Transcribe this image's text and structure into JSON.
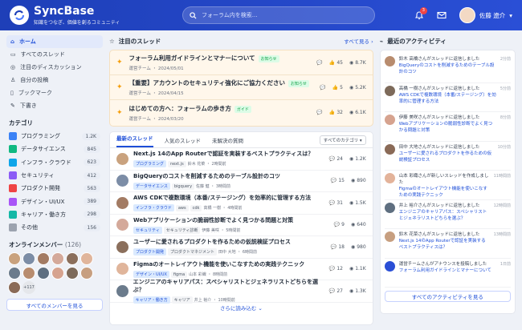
{
  "header": {
    "brand": "SyncBase",
    "tagline": "知識をつなぎ、価値を創るコミュニティ",
    "search_placeholder": "フォーラム内を検索...",
    "notif_count": "3",
    "username": "佐藤 遼介"
  },
  "colors": {
    "header_bg": "#1e3fb8",
    "accent": "#1d4ed8",
    "pin": "#f59e0b"
  },
  "nav": [
    {
      "label": "ホーム",
      "icon": "home-icon"
    },
    {
      "label": "すべてのスレッド",
      "icon": "thread-icon"
    },
    {
      "label": "注目のディスカッション",
      "icon": "chat-icon"
    },
    {
      "label": "自分の投稿",
      "icon": "user-icon"
    },
    {
      "label": "ブックマーク",
      "icon": "bookmark-icon"
    },
    {
      "label": "下書き",
      "icon": "draft-icon"
    }
  ],
  "categories_title": "カテゴリ",
  "categories": [
    {
      "name": "プログラミング",
      "count": "1.2K",
      "color": "#3b82f6"
    },
    {
      "name": "データサイエンス",
      "count": "845",
      "color": "#10b981"
    },
    {
      "name": "インフラ・クラウド",
      "count": "623",
      "color": "#0ea5e9"
    },
    {
      "name": "セキュリティ",
      "count": "412",
      "color": "#8b5cf6"
    },
    {
      "name": "プロダクト開発",
      "count": "563",
      "color": "#ef4444"
    },
    {
      "name": "デザイン・UI/UX",
      "count": "389",
      "color": "#a855f7"
    },
    {
      "name": "キャリア・働き方",
      "count": "298",
      "color": "#14b8a6"
    },
    {
      "name": "その他",
      "count": "156",
      "color": "#9ca3af"
    }
  ],
  "online": {
    "title": "オンラインメンバー",
    "count": "(126)",
    "more": "+117",
    "button": "すべてのメンバーを見る"
  },
  "pinned": {
    "title": "注目のスレッド",
    "see_all": "すべて見る",
    "items": [
      {
        "title": "フォーラム利用ガイドラインとマナーについて",
        "tag": "お知らせ",
        "tag_color": "#16a34a",
        "meta": "運営チーム ・ 2024/05/01",
        "comments": "",
        "likes": "45",
        "views": "8.7K"
      },
      {
        "title": "【重要】アカウントのセキュリティ強化にご協力ください",
        "tag": "お知らせ",
        "tag_color": "#16a34a",
        "meta": "運営チーム ・ 2024/04/15",
        "comments": "",
        "likes": "5",
        "views": "5.2K"
      },
      {
        "title": "はじめての方へ：フォーラムの歩き方",
        "tag": "ガイド",
        "tag_color": "#16a34a",
        "meta": "運営チーム ・ 2024/03/20",
        "comments": "",
        "likes": "32",
        "views": "6.1K"
      }
    ]
  },
  "tabs": [
    {
      "label": "最新のスレッド"
    },
    {
      "label": "人気のスレッド"
    },
    {
      "label": "未解決の質問"
    }
  ],
  "filter_label": "すべてのカテゴリ",
  "threads": [
    {
      "title": "Next.js 14のApp Routerで認証を実装するベストプラクティスは？",
      "chips": [
        "プログラミング",
        "next.js"
      ],
      "author": "鈴木 花菜",
      "time": "2時間前",
      "comments": "24",
      "views": "1.2K",
      "av": "#c9a27e"
    },
    {
      "title": "BigQueryのコストを削減するためのテーブル設計のコツ",
      "chips": [
        "データサイエンス",
        "bigquery"
      ],
      "author": "佐藤 健",
      "time": "3時間前",
      "comments": "15",
      "views": "890",
      "av": "#7c8da6"
    },
    {
      "title": "AWS CDKで複数環境（本番/ステージング）を効率的に管理する方法",
      "chips": [
        "インフラ・クラウド",
        "aws",
        "cdk"
      ],
      "author": "高橋 一樹",
      "time": "4時間前",
      "comments": "31",
      "views": "1.5K",
      "av": "#a37b63"
    },
    {
      "title": "Webアプリケーションの脆弱性診断でよく見つかる問題と対策",
      "chips": [
        "セキュリティ",
        "セキュリティ診断"
      ],
      "author": "伊藤 美咲",
      "time": "5時間前",
      "comments": "9",
      "views": "640",
      "av": "#d4a99a"
    },
    {
      "title": "ユーザーに愛されるプロダクトを作るための仮説検証プロセス",
      "chips": [
        "プロダクト開発",
        "プロダクトマネジメント"
      ],
      "author": "田中 大地",
      "time": "6時間前",
      "comments": "18",
      "views": "980",
      "av": "#8b6f5c"
    },
    {
      "title": "Figmaのオートレイアウト機能を使いこなすための実践テクニック",
      "chips": [
        "デザイン・UI/UX",
        "figma"
      ],
      "author": "山本 彩織",
      "time": "8時間前",
      "comments": "12",
      "views": "1.1K",
      "av": "#e0b59b"
    },
    {
      "title": "エンジニアのキャリアパス：スペシャリストとジェネラリストどちらを選ぶ？",
      "chips": [
        "キャリア・働き方",
        "キャリア"
      ],
      "author": "井上 裕介",
      "time": "10時間前",
      "comments": "27",
      "views": "1.3K",
      "av": "#6b7b8c"
    }
  ],
  "load_more": "さらに読み込む",
  "activity": {
    "title": "最近のアクティビティ",
    "button": "すべてのアクティビティを見る",
    "items": [
      {
        "text": "鈴木 高橋さんがスレッドに返信しました",
        "link": "BigQueryのコストを削減するためのテーブル設計のコツ",
        "time": "2分前",
        "av": "#b88c6e"
      },
      {
        "text": "高橋 一樹さんがスレッドに返信しました",
        "link": "AWS CDKで複数環境（本番/ステージング）を効率的に管理する方法",
        "time": "5分前",
        "av": "#7d6a5a"
      },
      {
        "text": "伊藤 美咲さんがスレッドに返信しました",
        "link": "Webアプリケーションの脆弱性診断でよく見つかる問題と対策",
        "time": "8分前",
        "av": "#d6a38f"
      },
      {
        "text": "田中 大地さんがスレッドに返信しました",
        "link": "ユーザーに愛されるプロダクトを作るための仮説検証プロセス",
        "time": "10分前",
        "av": "#8a6a57"
      },
      {
        "text": "山本 彩織さんが新しいスレッドを作成しました",
        "link": "Figmaのオートレイアウト機能を使いこなすための実践テクニック",
        "time": "11時間前",
        "av": "#e3b39a"
      },
      {
        "text": "井上 裕介さんがスレッドに返信しました",
        "link": "エンジニアのキャリアパス：スペシャリストとジェネラリストどちらを選ぶ？",
        "time": "12時間前",
        "av": "#5f6f80"
      },
      {
        "text": "鈴木 花菜さんがスレッドに返信しました",
        "link": "Next.js 14のApp Routerで認証を実装するベストプラクティスは？",
        "time": "13時間前",
        "av": "#c79f80"
      },
      {
        "text": "運営チームさんがアナウンスを投稿しました",
        "link": "フォーラム利用ガイドラインとマナーについて",
        "time": "1日前",
        "av": "#2a4fd6"
      }
    ]
  }
}
